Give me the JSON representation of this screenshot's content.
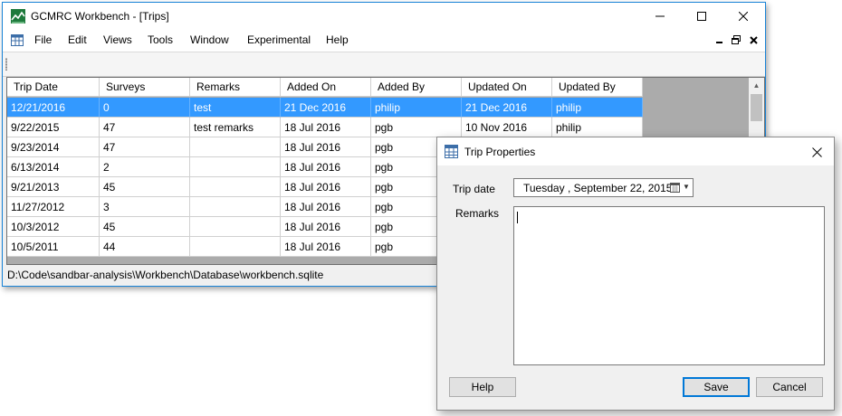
{
  "window": {
    "title": "GCMRC Workbench - [Trips]",
    "status_path": "D:\\Code\\sandbar-analysis\\Workbench\\Database\\workbench.sqlite"
  },
  "menu": [
    "File",
    "Edit",
    "Views",
    "Tools",
    "Window",
    "Experimental",
    "Help"
  ],
  "grid": {
    "columns": [
      "Trip Date",
      "Surveys",
      "Remarks",
      "Added On",
      "Added By",
      "Updated On",
      "Updated By"
    ],
    "rows": [
      [
        "12/21/2016",
        "0",
        "test",
        "21 Dec 2016",
        "philip",
        "21 Dec 2016",
        "philip"
      ],
      [
        "9/22/2015",
        "47",
        "test remarks",
        "18 Jul 2016",
        "pgb",
        "10 Nov 2016",
        "philip"
      ],
      [
        "9/23/2014",
        "47",
        "",
        "18 Jul 2016",
        "pgb",
        "",
        ""
      ],
      [
        "6/13/2014",
        "2",
        "",
        "18 Jul 2016",
        "pgb",
        "",
        ""
      ],
      [
        "9/21/2013",
        "45",
        "",
        "18 Jul 2016",
        "pgb",
        "",
        ""
      ],
      [
        "11/27/2012",
        "3",
        "",
        "18 Jul 2016",
        "pgb",
        "",
        ""
      ],
      [
        "10/3/2012",
        "45",
        "",
        "18 Jul 2016",
        "pgb",
        "",
        ""
      ],
      [
        "10/5/2011",
        "44",
        "",
        "18 Jul 2016",
        "pgb",
        "",
        ""
      ]
    ],
    "selected_row": 0
  },
  "dialog": {
    "title": "Trip Properties",
    "trip_date_label": "Trip date",
    "date_day": "Tuesday",
    "date_rest": ", September 22, 2015",
    "remarks_label": "Remarks",
    "remarks_value": "",
    "help_label": "Help",
    "save_label": "Save",
    "cancel_label": "Cancel"
  },
  "colors": {
    "selection": "#3399ff",
    "window_border": "#1883d7",
    "default_button_border": "#0078d7"
  }
}
